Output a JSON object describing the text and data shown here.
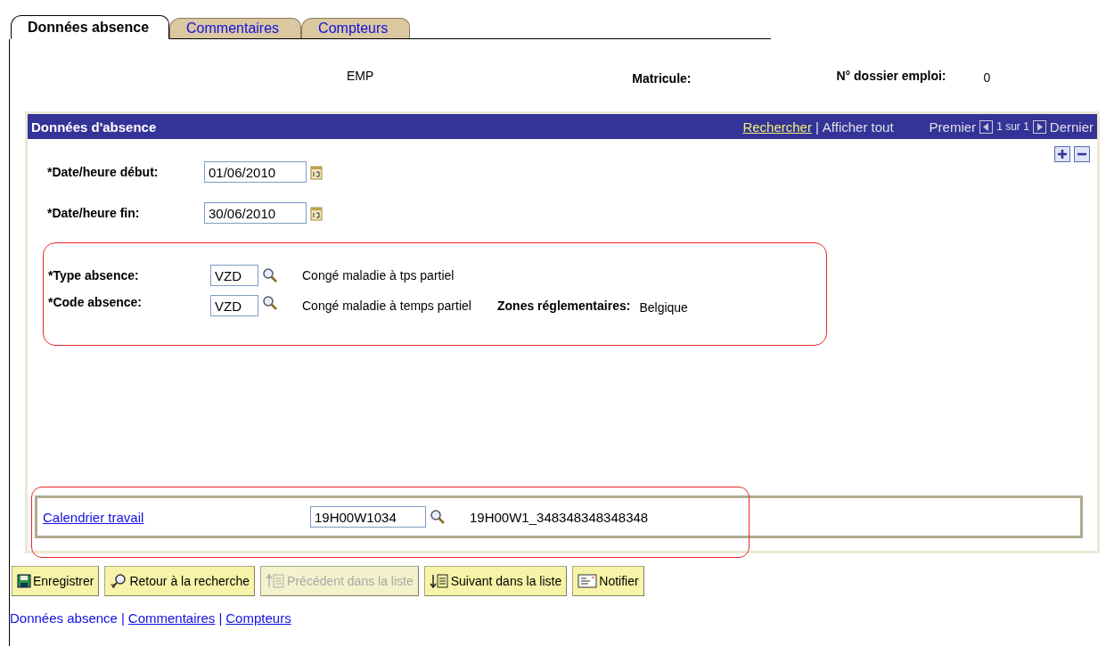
{
  "tabs": [
    {
      "label": "Données absence",
      "selected": true
    },
    {
      "label": "Commentaires",
      "selected": false
    },
    {
      "label": "Compteurs",
      "selected": false
    }
  ],
  "header": {
    "employee": "EMP",
    "matricule_label": "Matricule:",
    "dossier_label": "N° dossier emploi:",
    "dossier_value": "0"
  },
  "section": {
    "title": "Données d'absence",
    "search_link": "Rechercher",
    "separator": "|",
    "show_all": "Afficher tout",
    "first": "Premier",
    "count": "1 sur 1",
    "last": "Dernier"
  },
  "dates": [
    {
      "label": "*Date/heure début:",
      "value": "01/06/2010"
    },
    {
      "label": "*Date/heure fin:",
      "value": "30/06/2010"
    }
  ],
  "codes": [
    {
      "label": "*Type absence:",
      "value": "VZD",
      "description": "Congé maladie à tps partiel"
    },
    {
      "label": "*Code absence:",
      "value": "VZD",
      "description": "Congé maladie à temps partiel",
      "extra_label": "Zones réglementaires:",
      "extra_value": "Belgique"
    }
  ],
  "calendar": {
    "label": "Calendrier travail",
    "value": "19H00W1034",
    "description": "19H00W1_348348348348348"
  },
  "buttons": [
    {
      "kind": "save",
      "label": "Enregistrer",
      "disabled": false
    },
    {
      "kind": "back",
      "label": "Retour à la recherche",
      "disabled": false
    },
    {
      "kind": "previous",
      "label": "Précédent dans la liste",
      "disabled": true
    },
    {
      "kind": "next",
      "label": "Suivant dans la liste",
      "disabled": false
    },
    {
      "kind": "notify",
      "label": "Notifier",
      "disabled": false
    }
  ],
  "footer_links": [
    {
      "label": "Données absence",
      "selected": true
    },
    {
      "label": "Commentaires",
      "selected": false
    },
    {
      "label": "Compteurs",
      "selected": false
    }
  ],
  "footer_separator": "|"
}
